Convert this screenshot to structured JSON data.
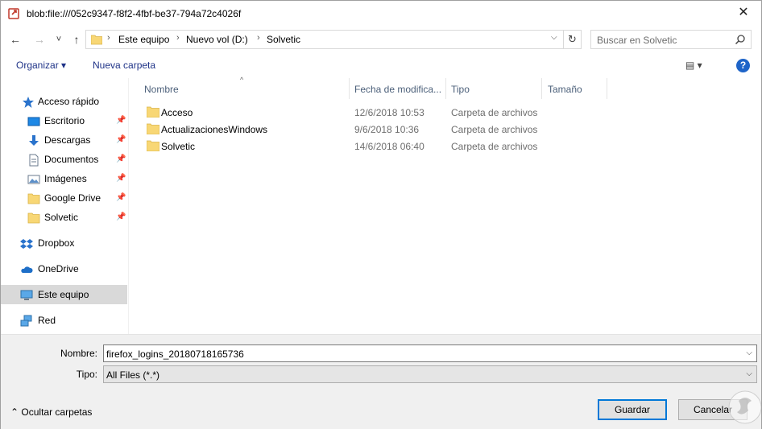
{
  "window": {
    "title": "blob:file:///052c9347-f8f2-4fbf-be37-794a72c4026f",
    "close_glyph": "✕"
  },
  "nav": {
    "back_glyph": "←",
    "forward_glyph": "→",
    "recent_glyph": "˅",
    "up_glyph": "↑",
    "breadcrumb": [
      "Este equipo",
      "Nuevo vol (D:)",
      "Solvetic"
    ],
    "separator_glyph": "›",
    "dropdown_glyph": "⌵",
    "refresh_glyph": "↻",
    "search_placeholder": "Buscar en Solvetic"
  },
  "toolbar": {
    "organize_label": "Organizar ▾",
    "new_folder_label": "Nueva carpeta",
    "view_glyph": "▤ ▾",
    "help_glyph": "?"
  },
  "sidebar": {
    "items": [
      {
        "label": "Acceso rápido",
        "icon": "star-icon",
        "pinned": false
      },
      {
        "label": "Escritorio",
        "icon": "desktop-icon",
        "pinned": true
      },
      {
        "label": "Descargas",
        "icon": "download-icon",
        "pinned": true
      },
      {
        "label": "Documentos",
        "icon": "document-icon",
        "pinned": true
      },
      {
        "label": "Imágenes",
        "icon": "pictures-icon",
        "pinned": true
      },
      {
        "label": "Google Drive",
        "icon": "folder-icon",
        "pinned": true
      },
      {
        "label": "Solvetic",
        "icon": "folder-icon",
        "pinned": true
      },
      {
        "label": "Dropbox",
        "icon": "dropbox-icon",
        "pinned": false
      },
      {
        "label": "OneDrive",
        "icon": "cloud-icon",
        "pinned": false
      },
      {
        "label": "Este equipo",
        "icon": "computer-icon",
        "pinned": false,
        "selected": true
      },
      {
        "label": "Red",
        "icon": "network-icon",
        "pinned": false
      }
    ],
    "pin_glyph": "📌"
  },
  "filelist": {
    "columns": [
      "Nombre",
      "Fecha de modifica...",
      "Tipo",
      "Tamaño"
    ],
    "sort_glyph": "^",
    "rows": [
      {
        "name": "Acceso",
        "date": "12/6/2018 10:53",
        "type": "Carpeta de archivos"
      },
      {
        "name": "ActualizacionesWindows",
        "date": "9/6/2018 10:36",
        "type": "Carpeta de archivos"
      },
      {
        "name": "Solvetic",
        "date": "14/6/2018 06:40",
        "type": "Carpeta de archivos"
      }
    ]
  },
  "form": {
    "name_label": "Nombre:",
    "name_value": "firefox_logins_20180718165736",
    "type_label": "Tipo:",
    "type_value": "All Files (*.*)",
    "dropdown_glyph": "⌵",
    "hide_folders_label": "⌃  Ocultar carpetas",
    "save_label": "Guardar",
    "cancel_label": "Cancelar"
  },
  "colors": {
    "accent": "#0078d7",
    "toolbar_text": "#1e3287",
    "folder": "#f8d775",
    "header_text": "#4c607a"
  }
}
